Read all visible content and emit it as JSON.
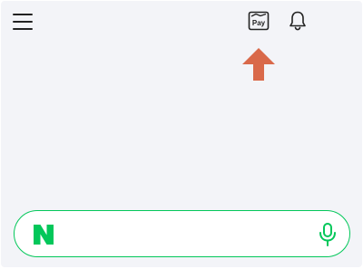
{
  "header": {
    "menu_icon": "hamburger-menu-icon",
    "pay_button": {
      "icon": "naver-pay-wallet-icon",
      "label": "Pay"
    },
    "notification_icon": "bell-icon"
  },
  "annotation": {
    "icon": "up-arrow-icon",
    "color": "#d9694a"
  },
  "search": {
    "logo_icon": "naver-n-logo",
    "placeholder": "",
    "value": "",
    "mic_icon": "microphone-icon",
    "accent_color": "#03c75a"
  }
}
